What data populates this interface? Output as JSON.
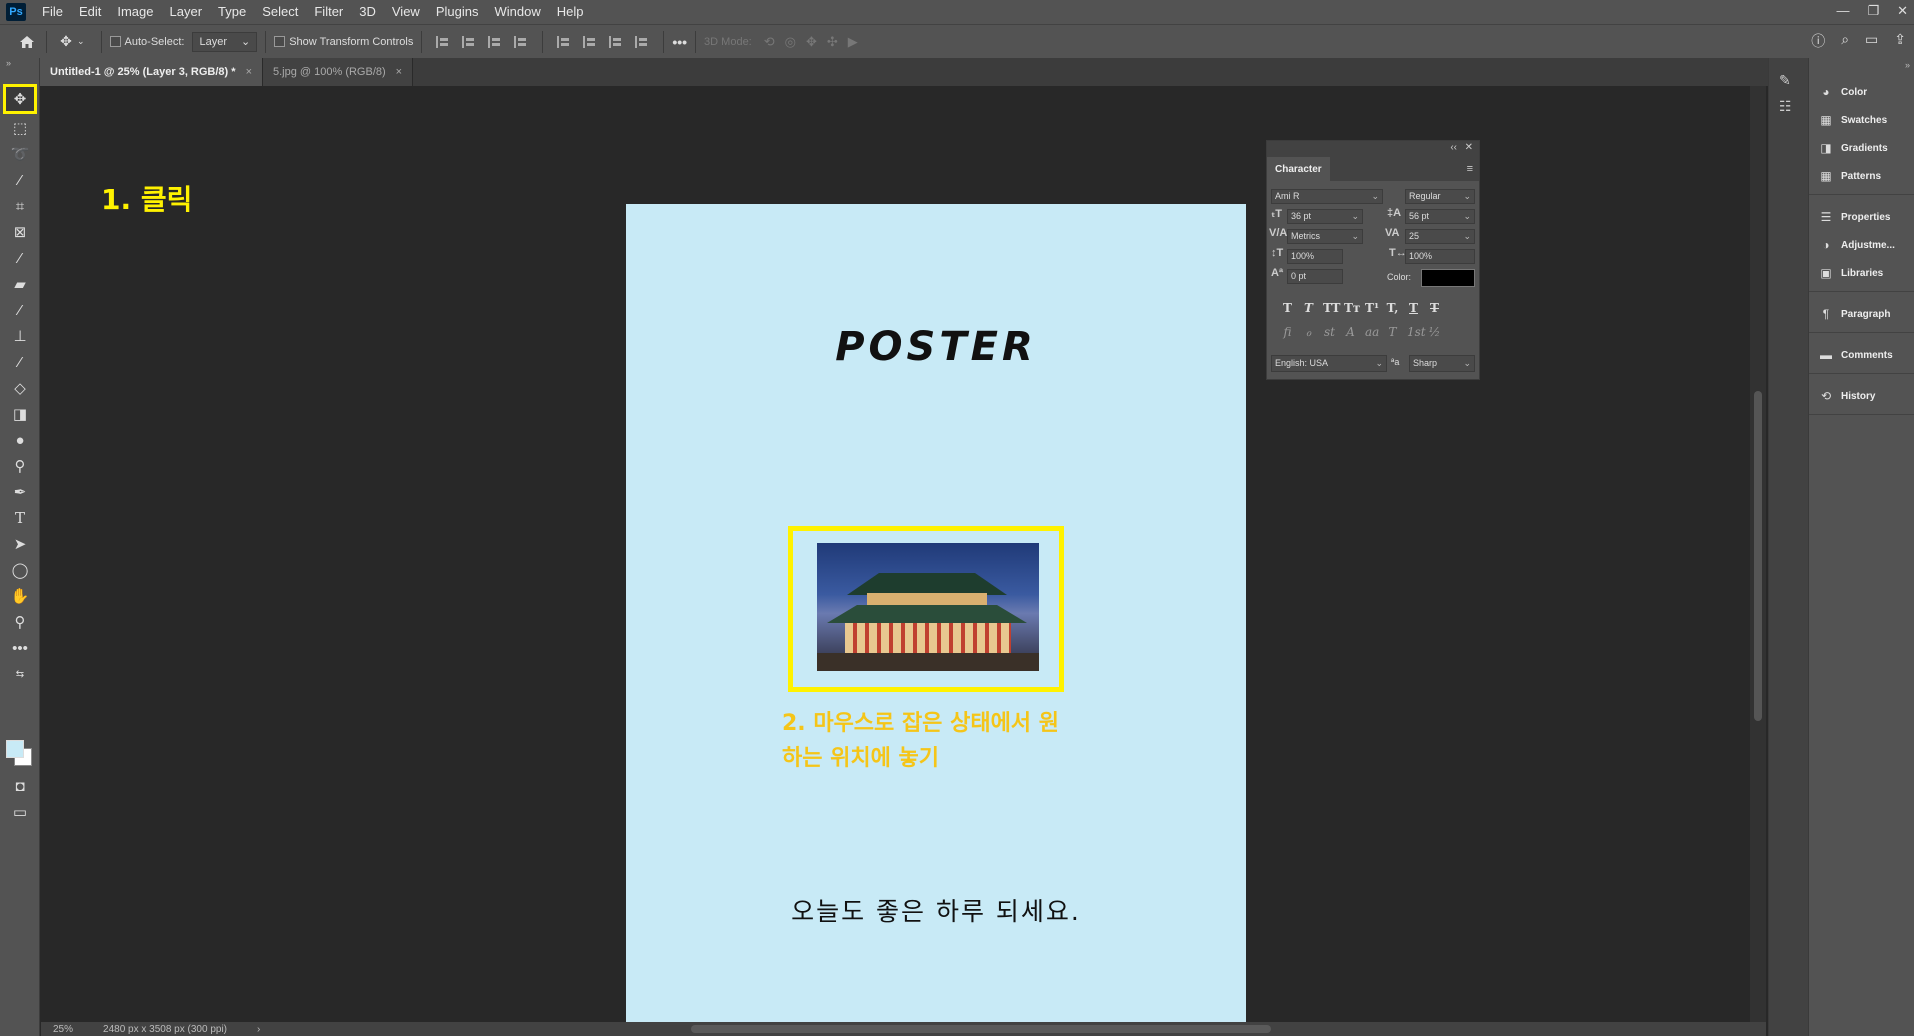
{
  "app": {
    "logo": "Ps",
    "menu": [
      "File",
      "Edit",
      "Image",
      "Layer",
      "Type",
      "Select",
      "Filter",
      "3D",
      "View",
      "Plugins",
      "Window",
      "Help"
    ],
    "window_controls": [
      "—",
      "❐",
      "✕"
    ]
  },
  "options_bar": {
    "auto_select_label": "Auto-Select:",
    "auto_select_value": "Layer",
    "show_transform_label": "Show Transform Controls",
    "three_d_mode_label": "3D Mode:",
    "more": "•••"
  },
  "tabs": [
    {
      "label": "Untitled-1 @ 25% (Layer 3, RGB/8) *",
      "close": "×"
    },
    {
      "label": "5.jpg @ 100% (RGB/8)",
      "close": "×"
    }
  ],
  "toolbar": {
    "collapse": "»",
    "tools": [
      "move",
      "marquee",
      "lasso",
      "magic-wand",
      "crop",
      "frame",
      "eyedropper",
      "healing-brush",
      "brush",
      "clone-stamp",
      "history-brush",
      "eraser",
      "gradient",
      "blur",
      "dodge",
      "pen",
      "type",
      "path-selection",
      "ellipse",
      "hand",
      "zoom",
      "more"
    ],
    "foreground_color": "#c8eaf6",
    "background_color": "#ffffff"
  },
  "canvas": {
    "poster_title": "POSTER",
    "annotation_step1": "1. 클릭",
    "annotation_step2_line1": "2. 마우스로 잡은 상태에서 원",
    "annotation_step2_line2": "하는 위치에 놓기",
    "greeting": "오늘도 좋은 하루 되세요.",
    "background_color": "#c8eaf6",
    "highlight_color": "#fff200",
    "annotation2_color": "#f5c518"
  },
  "status": {
    "zoom": "25%",
    "doc_size": "2480 px x 3508 px (300 ppi)",
    "nav_arrow": "›"
  },
  "character_panel": {
    "collapse": "‹‹",
    "close": "✕",
    "title": "Character",
    "menu": "≡",
    "font_family": "Ami R",
    "font_style": "Regular",
    "font_size": "36 pt",
    "leading": "56 pt",
    "kerning": "Metrics",
    "tracking": "25",
    "vertical_scale": "100%",
    "horizontal_scale": "100%",
    "baseline_shift": "0 pt",
    "color_label": "Color:",
    "color_value": "#000000",
    "language": "English: USA",
    "aa_label": "ªa",
    "anti_alias": "Sharp",
    "typo_buttons": [
      "T",
      "T",
      "TT",
      "Tт",
      "T¹",
      "T,",
      "T",
      "T"
    ],
    "opentype_buttons": [
      "fi",
      "ℴ",
      "st",
      "A",
      "aa",
      "T",
      "1st",
      "½"
    ]
  },
  "right_dock": {
    "collapse": "»",
    "panels": [
      {
        "label": "Color",
        "icon": "palette-icon",
        "glyph": "◕"
      },
      {
        "label": "Swatches",
        "icon": "grid-icon",
        "glyph": "▦"
      },
      {
        "label": "Gradients",
        "icon": "gradient-icon",
        "glyph": "◨"
      },
      {
        "label": "Patterns",
        "icon": "pattern-icon",
        "glyph": "▦"
      },
      {
        "label": "Properties",
        "icon": "sliders-icon",
        "glyph": "☰"
      },
      {
        "label": "Adjustme...",
        "icon": "adjustments-icon",
        "glyph": "◑"
      },
      {
        "label": "Libraries",
        "icon": "libraries-icon",
        "glyph": "▣"
      },
      {
        "label": "Paragraph",
        "icon": "paragraph-icon",
        "glyph": "¶"
      },
      {
        "label": "Comments",
        "icon": "comment-icon",
        "glyph": "▬"
      },
      {
        "label": "History",
        "icon": "history-icon",
        "glyph": "⟲"
      }
    ]
  }
}
